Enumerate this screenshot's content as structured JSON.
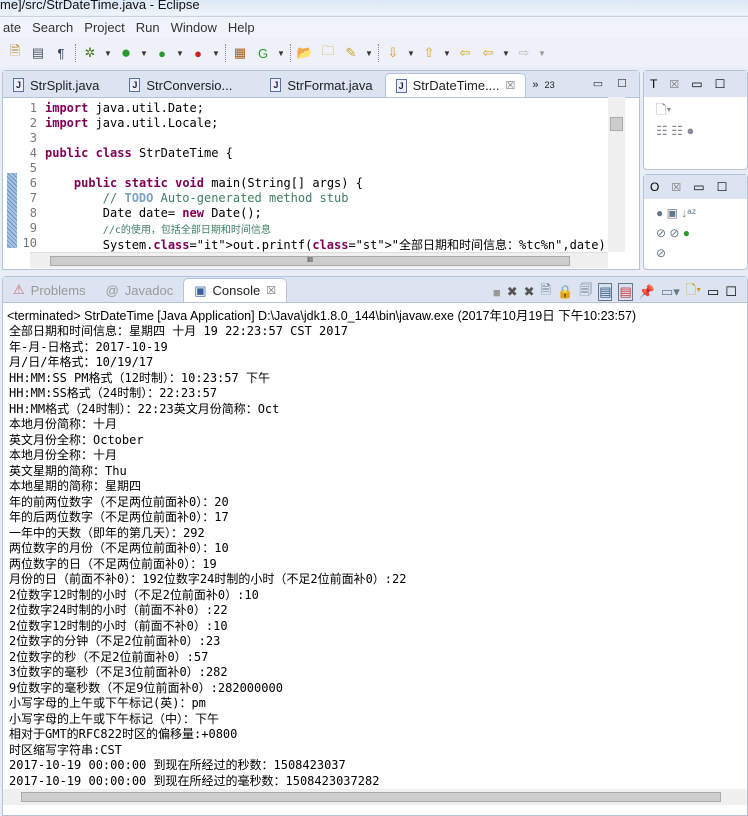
{
  "window": {
    "title": "me]/src/StrDateTime.java - Eclipse"
  },
  "menu": [
    "ate",
    "Search",
    "Project",
    "Run",
    "Window",
    "Help"
  ],
  "toolbar": {
    "icons": [
      "save-icon",
      "print-icon",
      "toggle-icon",
      "pilcrow-icon",
      "debug-icon",
      "run-icon",
      "coverage-icon",
      "external-tools-icon",
      "new-class-icon",
      "new-java-project-icon",
      "open-type-icon",
      "open-folder-icon",
      "search-icon",
      "next-annotation-icon",
      "prev-annotation-icon",
      "last-edit-icon",
      "back-icon",
      "forward-icon"
    ]
  },
  "editor": {
    "tabs": [
      {
        "label": "StrSplit.java"
      },
      {
        "label": "StrConversio..."
      },
      {
        "label": "StrFormat.java"
      },
      {
        "label": "StrDateTime....",
        "active": true
      }
    ],
    "overflow": "23",
    "lines": [
      {
        "n": "1",
        "text": "import java.util.Date;"
      },
      {
        "n": "2",
        "text": "import java.util.Locale;"
      },
      {
        "n": "3",
        "text": ""
      },
      {
        "n": "4",
        "text": "public class StrDateTime {"
      },
      {
        "n": "5",
        "text": ""
      },
      {
        "n": "6",
        "text": "    public static void main(String[] args) {"
      },
      {
        "n": "7",
        "text": "        // TODO Auto-generated method stub"
      },
      {
        "n": "8",
        "text": "        Date date= new Date();"
      },
      {
        "n": "9",
        "text": "        //c的使用，包括全部日期和时间信息"
      },
      {
        "n": "10",
        "text": "        System.out.printf(\"全部日期和时间信息：%tc%n\",date);"
      }
    ],
    "scroll_marker": "III"
  },
  "right_panels": {
    "top_tab": "T",
    "bottom_tab": "O"
  },
  "console": {
    "tabs": [
      {
        "label": "Problems"
      },
      {
        "label": "Javadoc"
      },
      {
        "label": "Console",
        "active": true
      }
    ],
    "terminated": "<terminated> StrDateTime [Java Application] D:\\Java\\jdk1.8.0_144\\bin\\javaw.exe (2017年10月19日 下午10:23:57)",
    "output": [
      "全部日期和时间信息：星期四 十月 19 22:23:57 CST 2017",
      "年-月-日格式：2017-10-19",
      "月/日/年格式：10/19/17",
      "HH:MM:SS PM格式（12时制）：10:23:57 下午",
      "HH:MM:SS格式（24时制）：22:23:57",
      "HH:MM格式（24时制）：22:23英文月份简称：Oct",
      "本地月份简称：十月",
      "英文月份全称：October",
      "本地月份全称：十月",
      "英文星期的简称：Thu",
      "本地星期的简称：星期四",
      "年的前两位数字（不足两位前面补0）：20",
      "年的后两位数字（不足两位前面补0）：17",
      "一年中的天数（即年的第几天）：292",
      "两位数字的月份（不足两位前面补0）：10",
      "两位数字的日（不足两位前面补0）：19",
      "月份的日（前面不补0）：192位数字24时制的小时（不足2位前面补0）:22",
      "2位数字12时制的小时（不足2位前面补0）:10",
      "2位数字24时制的小时（前面不补0）:22",
      "2位数字12时制的小时（前面不补0）:10",
      "2位数字的分钟（不足2位前面补0）:23",
      "2位数字的秒（不足2位前面补0）:57",
      "3位数字的毫秒（不足3位前面补0）:282",
      "9位数字的毫秒数（不足9位前面补0）:282000000",
      "小写字母的上午或下午标记(英)：pm",
      "小写字母的上午或下午标记（中）：下午",
      "相对于GMT的RFC822时区的偏移量:+0800",
      "时区缩写字符串:CST",
      "2017-10-19 00:00:00 到现在所经过的秒数：1508423037",
      "2017-10-19 00:00:00 到现在所经过的毫秒数：1508423037282"
    ]
  }
}
